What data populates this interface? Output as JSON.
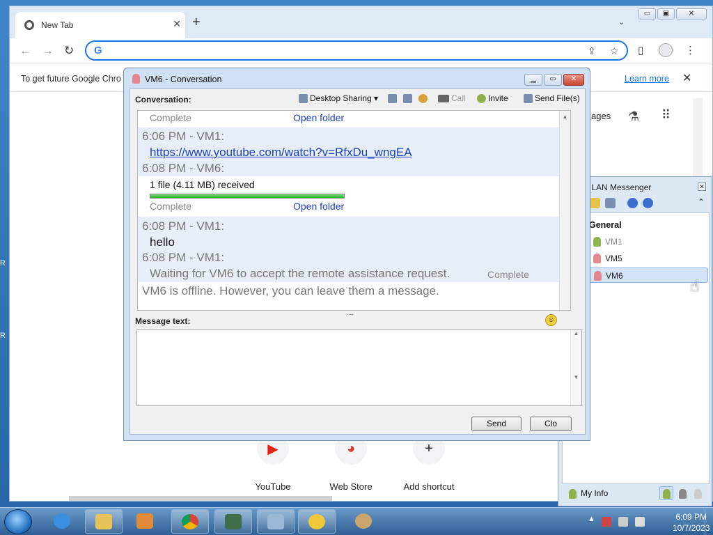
{
  "desktop": {
    "edge_letters": [
      "R",
      "R"
    ]
  },
  "chrome": {
    "tab_title": "New Tab",
    "tab_close": "✕",
    "new_tab": "+",
    "tab_menu": "⌄",
    "window_buttons": [
      "▭",
      "▣",
      "✕"
    ],
    "infobar_text": "To get future Google Chro",
    "infobar_link": "Learn more",
    "infobar_close": "✕",
    "ntp_partial": "ages",
    "shortcuts": [
      {
        "label": "YouTube",
        "icon": "▶",
        "color": "#e62117"
      },
      {
        "label": "Web Store",
        "icon": "◕",
        "color": "#d33"
      },
      {
        "label": "Add shortcut",
        "icon": "+",
        "color": "#333"
      }
    ]
  },
  "conversation": {
    "title": "VM6 - Conversation",
    "label": "Conversation:",
    "tools": {
      "desktop_sharing": "Desktop Sharing ▾",
      "call": "Call",
      "invite": "Invite",
      "send_files": "Send File(s)"
    },
    "messages": {
      "top_complete": "Complete",
      "top_open": "Open folder",
      "m1_header": "6:06 PM - VM1:",
      "m1_link": "https://www.youtube.com/watch?v=RfxDu_wngEA",
      "m2_header": "6:08 PM - VM6:",
      "m2_text": "1 file (4.11 MB) received",
      "m2_progress": 1.0,
      "m2_complete": "Complete",
      "m2_open": "Open folder",
      "m3_header": "6:08 PM - VM1:",
      "m3_text": "hello",
      "m4_header": "6:08 PM - VM1:",
      "m4_text": "Waiting for VM6 to accept the remote assistance request.",
      "m4_status": "Complete",
      "offline": "VM6 is offline. However, you can leave them a message."
    },
    "splitter": "....",
    "message_label": "Message text:",
    "send": "Send",
    "close": "Clo"
  },
  "softros": {
    "title": "Softros LAN Messenger",
    "group": "General",
    "users": [
      {
        "name": "VM1",
        "status": "offline"
      },
      {
        "name": "VM5",
        "status": "online"
      },
      {
        "name": "VM6",
        "status": "selected"
      }
    ],
    "my_info": "My Info"
  },
  "taskbar": {
    "time": "6:09 PM",
    "date": "10/7/2023"
  }
}
